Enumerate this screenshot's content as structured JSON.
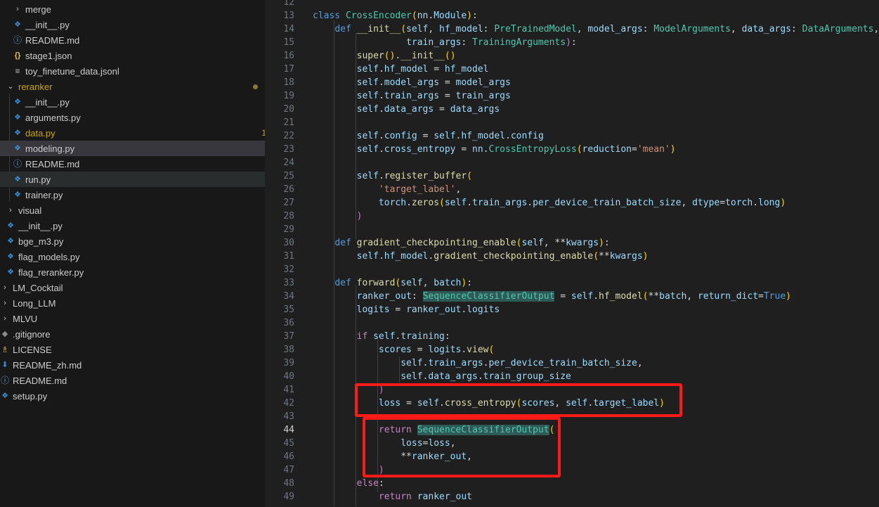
{
  "explorer": {
    "items": [
      {
        "label": "merge",
        "icon": "chevron-right-icon",
        "type": "folder"
      },
      {
        "label": "__init__.py",
        "icon": "python-file-icon",
        "type": "file"
      },
      {
        "label": "README.md",
        "icon": "info-icon",
        "type": "file"
      },
      {
        "label": "stage1.json",
        "icon": "json-icon",
        "type": "file"
      },
      {
        "label": "toy_finetune_data.jsonl",
        "icon": "lines-icon",
        "type": "file"
      },
      {
        "label": "reranker",
        "icon": "chevron-down-icon",
        "type": "folder"
      },
      {
        "label": "__init__.py",
        "icon": "python-file-icon",
        "type": "file"
      },
      {
        "label": "arguments.py",
        "icon": "python-file-icon",
        "type": "file"
      },
      {
        "label": "data.py",
        "icon": "python-file-icon",
        "type": "file",
        "badge": "1"
      },
      {
        "label": "modeling.py",
        "icon": "python-file-icon",
        "type": "file"
      },
      {
        "label": "README.md",
        "icon": "info-icon",
        "type": "file"
      },
      {
        "label": "run.py",
        "icon": "python-file-icon",
        "type": "file"
      },
      {
        "label": "trainer.py",
        "icon": "python-file-icon",
        "type": "file"
      },
      {
        "label": "visual",
        "icon": "chevron-right-icon",
        "type": "folder"
      },
      {
        "label": "__init__.py",
        "icon": "python-file-icon",
        "type": "file"
      },
      {
        "label": "bge_m3.py",
        "icon": "python-file-icon",
        "type": "file"
      },
      {
        "label": "flag_models.py",
        "icon": "python-file-icon",
        "type": "file"
      },
      {
        "label": "flag_reranker.py",
        "icon": "python-file-icon",
        "type": "file"
      },
      {
        "label": "LM_Cocktail",
        "icon": "chevron-right-icon",
        "type": "folder"
      },
      {
        "label": "Long_LLM",
        "icon": "chevron-right-icon",
        "type": "folder"
      },
      {
        "label": "MLVU",
        "icon": "chevron-right-icon",
        "type": "folder"
      },
      {
        "label": ".gitignore",
        "icon": "git-icon",
        "type": "file"
      },
      {
        "label": "LICENSE",
        "icon": "license-icon",
        "type": "file"
      },
      {
        "label": "README_zh.md",
        "icon": "download-icon",
        "type": "file"
      },
      {
        "label": "README.md",
        "icon": "info-icon",
        "type": "file"
      },
      {
        "label": "setup.py",
        "icon": "python-file-icon",
        "type": "file"
      }
    ]
  },
  "editor": {
    "line_numbers": [
      "12",
      "13",
      "14",
      "15",
      "16",
      "17",
      "18",
      "19",
      "20",
      "21",
      "22",
      "23",
      "24",
      "25",
      "26",
      "27",
      "28",
      "29",
      "30",
      "31",
      "32",
      "33",
      "34",
      "35",
      "36",
      "37",
      "38",
      "39",
      "40",
      "41",
      "42",
      "43",
      "44",
      "45",
      "46",
      "47",
      "48",
      "49"
    ],
    "current_line": "44",
    "lines": [
      "",
      "class CrossEncoder(nn.Module):",
      "    def __init__(self, hf_model: PreTrainedModel, model_args: ModelArguments, data_args: DataArguments,",
      "                 train_args: TrainingArguments):",
      "        super().__init__()",
      "        self.hf_model = hf_model",
      "        self.model_args = model_args",
      "        self.train_args = train_args",
      "        self.data_args = data_args",
      "",
      "        self.config = self.hf_model.config",
      "        self.cross_entropy = nn.CrossEntropyLoss(reduction='mean')",
      "",
      "        self.register_buffer(",
      "            'target_label',",
      "            torch.zeros(self.train_args.per_device_train_batch_size, dtype=torch.long)",
      "        )",
      "",
      "    def gradient_checkpointing_enable(self, **kwargs):",
      "        self.hf_model.gradient_checkpointing_enable(**kwargs)",
      "",
      "    def forward(self, batch):",
      "        ranker_out: SequenceClassifierOutput = self.hf_model(**batch, return_dict=True)",
      "        logits = ranker_out.logits",
      "",
      "        if self.training:",
      "            scores = logits.view(",
      "                self.train_args.per_device_train_batch_size,",
      "                self.data_args.train_group_size",
      "            )",
      "            loss = self.cross_entropy(scores, self.target_label)",
      "",
      "            return SequenceClassifierOutput(",
      "                loss=loss,",
      "                **ranker_out,",
      "            )",
      "        else:",
      "            return ranker_out"
    ],
    "annotation_color": "#ff1a1a"
  }
}
